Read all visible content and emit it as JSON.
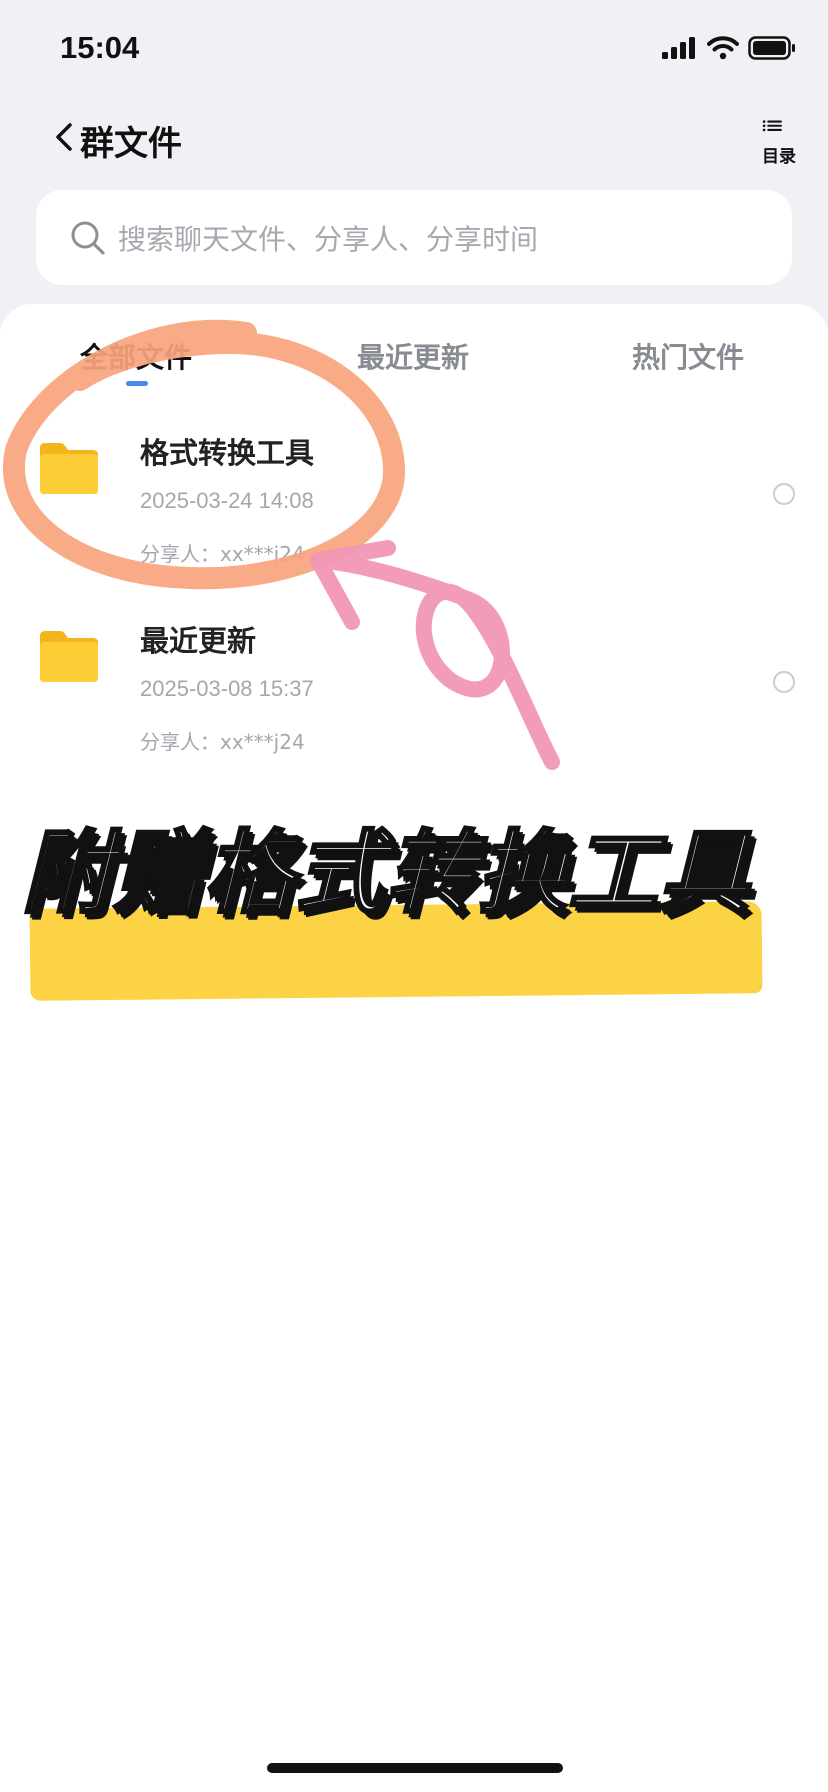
{
  "status_bar": {
    "time": "15:04"
  },
  "nav": {
    "title": "群文件",
    "menu_label": "目录"
  },
  "search": {
    "placeholder": "搜索聊天文件、分享人、分享时间"
  },
  "tabs": [
    {
      "label": "全部文件",
      "active": true
    },
    {
      "label": "最近更新",
      "active": false
    },
    {
      "label": "热门文件",
      "active": false
    }
  ],
  "files": [
    {
      "name": "格式转换工具",
      "date": "2025-03-24 14:08",
      "sharer": "分享人：xx***j24",
      "icon": "folder-icon"
    },
    {
      "name": "最近更新",
      "date": "2025-03-08 15:37",
      "sharer": "分享人：xx***j24",
      "icon": "folder-icon"
    }
  ],
  "overlay": {
    "caption": "附赠格式转换工具"
  },
  "colors": {
    "folder": "#fcc42c",
    "circle_annotation": "#f9a47e",
    "arrow_annotation": "#f197b5",
    "highlight": "#fdd346",
    "tab_indicator": "#4a88f0"
  }
}
